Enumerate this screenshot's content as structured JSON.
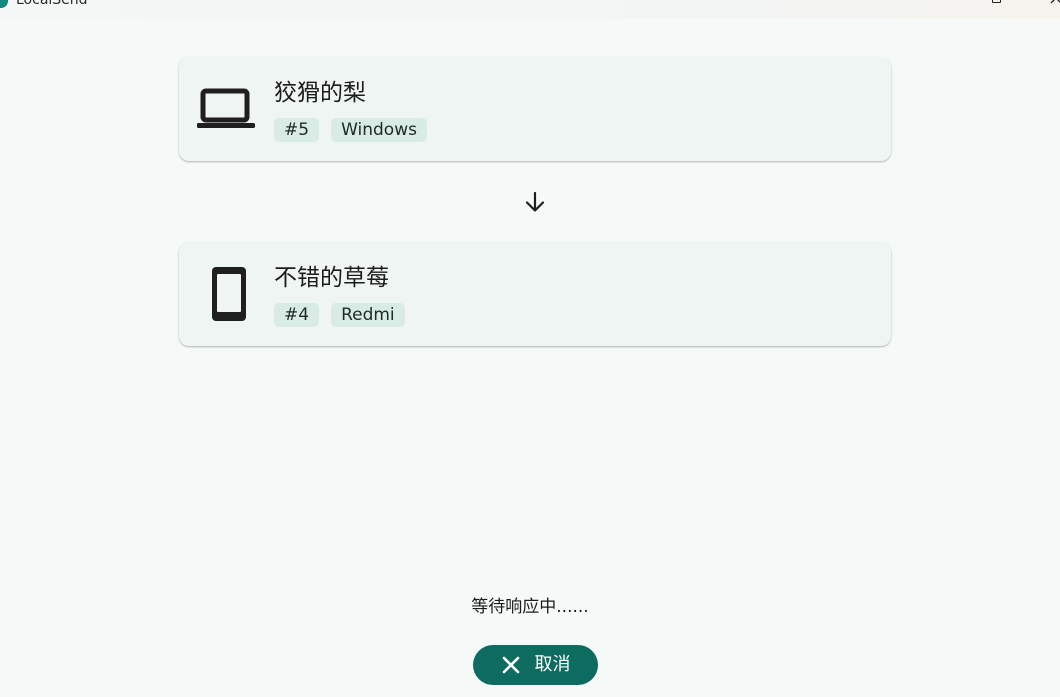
{
  "window": {
    "title": "LocalSend"
  },
  "sender": {
    "name": "狡猾的梨",
    "tags": [
      "#5",
      "Windows"
    ],
    "icon": "laptop-icon"
  },
  "receiver": {
    "name": "不错的草莓",
    "tags": [
      "#4",
      "Redmi"
    ],
    "icon": "phone-icon"
  },
  "status": {
    "text": "等待响应中......"
  },
  "actions": {
    "cancel_label": "取消",
    "cancel_icon": "close-icon"
  },
  "colors": {
    "background": "#f5faf8",
    "card": "#eff5f3",
    "tag": "#d8ebe5",
    "accent": "#0d6b5f"
  }
}
